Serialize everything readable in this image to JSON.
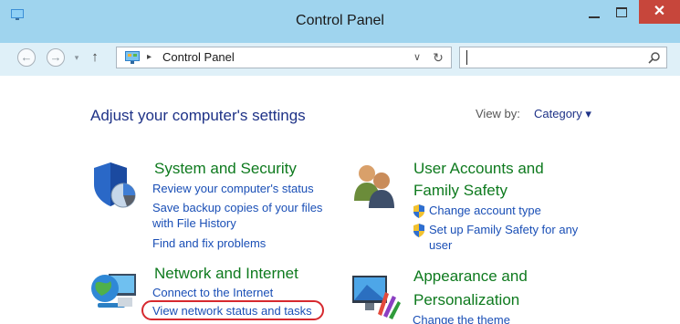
{
  "window": {
    "title": "Control Panel",
    "close_glyph": "✕"
  },
  "navigation": {
    "back_glyph": "←",
    "forward_glyph": "→",
    "dropdown_glyph": "▾",
    "up_glyph": "↑",
    "breadcrumb_separator": "▸",
    "address_text": "Control Panel",
    "address_dropdown_glyph": "∨",
    "refresh_glyph": "↻",
    "search_value": ""
  },
  "content": {
    "heading": "Adjust your computer's settings",
    "view_by_label": "View by:",
    "view_by_value": "Category ▾",
    "categories": [
      {
        "title": "System and Security",
        "links": [
          "Review your computer's status",
          "Save backup copies of your files",
          "with File History",
          "Find and fix problems"
        ]
      },
      {
        "title_line1": "User Accounts and",
        "title_line2": "Family Safety",
        "links": [
          "Change account type",
          "Set up Family Safety for any",
          "user"
        ]
      },
      {
        "title": "Network and Internet",
        "links": [
          "Connect to the Internet",
          "View network status and tasks"
        ]
      },
      {
        "title_line1": "Appearance and",
        "title_line2": "Personalization",
        "links": [
          "Change the theme"
        ]
      }
    ]
  },
  "colors": {
    "titlebar": "#9fd4ee",
    "close_button": "#c7463b",
    "heading_blue": "#1e3287",
    "category_green": "#0e7a1e",
    "link_blue": "#1a4fb6",
    "highlight_red": "#d6282e"
  },
  "icons": [
    "control-panel-icon",
    "search-icon",
    "shield-pie-icon",
    "users-icon",
    "network-globe-icon",
    "monitor-palette-icon",
    "uac-shield-icon"
  ]
}
